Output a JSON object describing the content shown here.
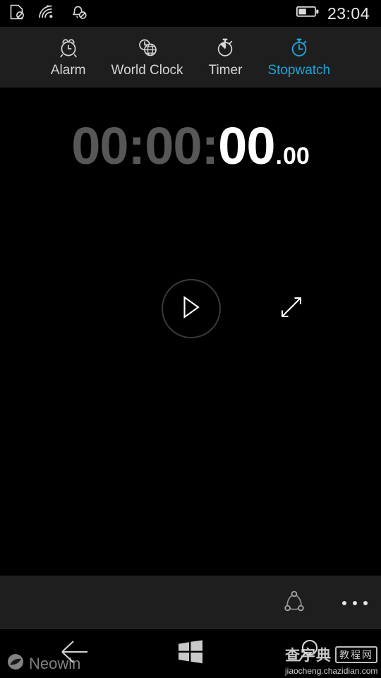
{
  "statusbar": {
    "icons": [
      {
        "name": "sim-card-disabled-icon",
        "glyph": "sim-off"
      },
      {
        "name": "wifi-icon",
        "glyph": "wifi"
      },
      {
        "name": "notification-bell-disabled-icon",
        "glyph": "bell-off"
      }
    ],
    "battery": {
      "name": "battery-icon",
      "level_percent": 45
    },
    "clock": "23:04"
  },
  "tabs": [
    {
      "label": "Alarm",
      "icon": "alarm-clock-icon",
      "active": false
    },
    {
      "label": "World Clock",
      "icon": "globe-clock-icon",
      "active": false
    },
    {
      "label": "Timer",
      "icon": "timer-icon",
      "active": false
    },
    {
      "label": "Stopwatch",
      "icon": "stopwatch-icon",
      "active": true
    }
  ],
  "stopwatch": {
    "hours": "00",
    "minutes": "00",
    "seconds": "00",
    "hundredths": "00",
    "separator": ":",
    "decimal": ".",
    "play_button": "play-icon",
    "expand_button": "expand-icon"
  },
  "appbar": {
    "share_label": "share-icon",
    "more_label": "more-options-icon"
  },
  "navbar": {
    "back": "back-arrow-icon",
    "start": "windows-start-icon",
    "search": "search-icon"
  },
  "watermarks": {
    "neowin": "Neowin",
    "cn_brand": "查字典",
    "cn_box": "教程网",
    "cn_url": "jiaocheng.chazidian.com"
  },
  "colors": {
    "accent": "#1ba4d8",
    "tabbar_bg": "#1e1e1e",
    "appbar_bg": "#1e1e1e",
    "content_bg": "#000000",
    "dim_text": "#575757",
    "bright_text": "#ffffff"
  }
}
